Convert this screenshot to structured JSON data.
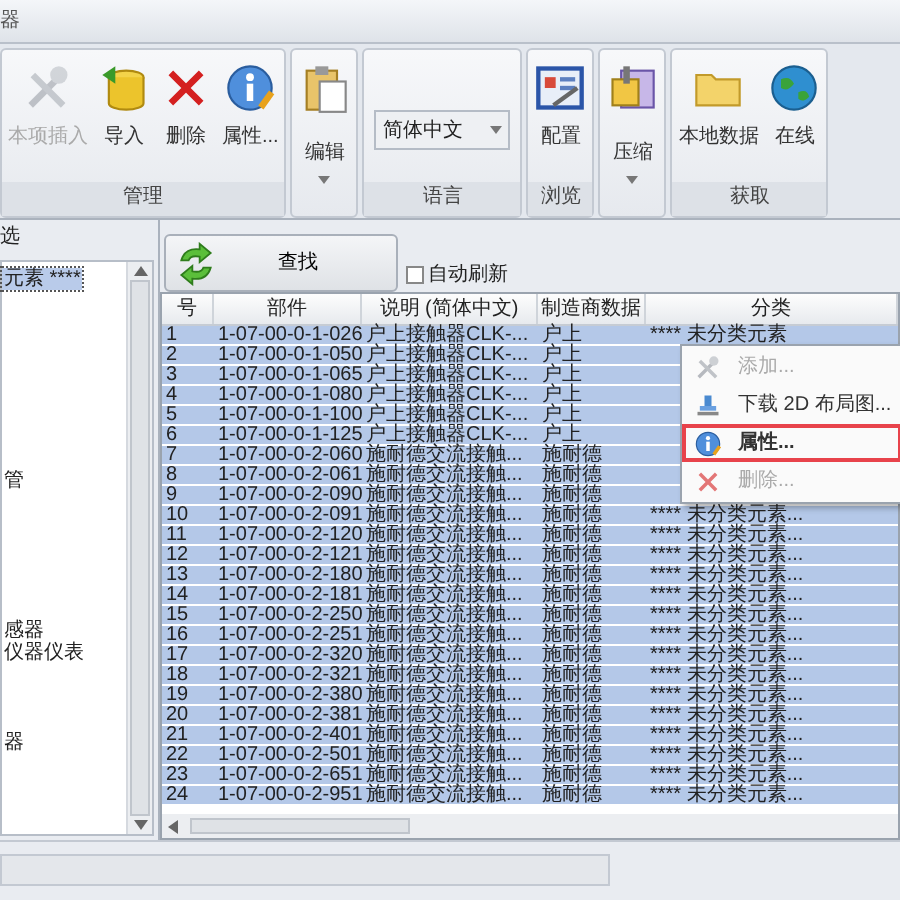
{
  "window": {
    "title": "器"
  },
  "ribbon": {
    "groups": [
      {
        "label": "管理",
        "buttons": [
          {
            "label": "本项插入",
            "disabled": true
          },
          {
            "label": "导入",
            "disabled": false
          },
          {
            "label": "删除",
            "disabled": false
          },
          {
            "label": "属性...",
            "disabled": false
          }
        ]
      },
      {
        "buttons": [
          {
            "label": "编辑",
            "disabled": false,
            "dropdown": true
          }
        ]
      },
      {
        "label": "语言",
        "select": {
          "value": "简体中文"
        }
      },
      {
        "label": "浏览",
        "buttons": [
          {
            "label": "配置",
            "disabled": false
          }
        ]
      },
      {
        "buttons": [
          {
            "label": "压缩",
            "disabled": false,
            "dropdown": true
          }
        ]
      },
      {
        "label": "获取",
        "buttons": [
          {
            "label": "本地数据",
            "disabled": false
          },
          {
            "label": "在线",
            "disabled": false
          }
        ]
      }
    ]
  },
  "left_panel": {
    "header": "选",
    "tree": [
      {
        "label": "元素 ****",
        "selected": true
      },
      {
        "label": "管",
        "selected": false
      },
      {
        "label": "感器",
        "selected": false
      },
      {
        "label": "仪器仪表",
        "selected": false
      },
      {
        "label": "器",
        "selected": false
      }
    ]
  },
  "find_button": "查找",
  "auto_refresh": {
    "label": "自动刷新",
    "checked": false
  },
  "table": {
    "columns": [
      "号",
      "部件",
      "说明 (简体中文)",
      "制造商数据",
      "分类"
    ],
    "rows": [
      {
        "cells": [
          "1",
          "1-07-00-0-1-026",
          "户上接触器CLK-...",
          "户上",
          "**** 未分类元素"
        ],
        "selected": true
      },
      {
        "cells": [
          "2",
          "1-07-00-0-1-050",
          "户上接触器CLK-...",
          "户上"
        ],
        "selected": true
      },
      {
        "cells": [
          "3",
          "1-07-00-0-1-065",
          "户上接触器CLK-...",
          "户上"
        ],
        "selected": true
      },
      {
        "cells": [
          "4",
          "1-07-00-0-1-080",
          "户上接触器CLK-...",
          "户上"
        ],
        "selected": true
      },
      {
        "cells": [
          "5",
          "1-07-00-0-1-100",
          "户上接触器CLK-...",
          "户上"
        ],
        "selected": true
      },
      {
        "cells": [
          "6",
          "1-07-00-0-1-125",
          "户上接触器CLK-...",
          "户上"
        ],
        "selected": true
      },
      {
        "cells": [
          "7",
          "1-07-00-0-2-060",
          "施耐德交流接触...",
          "施耐德"
        ],
        "selected": true
      },
      {
        "cells": [
          "8",
          "1-07-00-0-2-061",
          "施耐德交流接触...",
          "施耐德"
        ],
        "selected": true
      },
      {
        "cells": [
          "9",
          "1-07-00-0-2-090",
          "施耐德交流接触...",
          "施耐德"
        ],
        "selected": true
      },
      {
        "cells": [
          "10",
          "1-07-00-0-2-091",
          "施耐德交流接触...",
          "施耐德",
          "**** 未分类元素..."
        ],
        "selected": true
      },
      {
        "cells": [
          "11",
          "1-07-00-0-2-120",
          "施耐德交流接触...",
          "施耐德",
          "**** 未分类元素..."
        ],
        "selected": true
      },
      {
        "cells": [
          "12",
          "1-07-00-0-2-121",
          "施耐德交流接触...",
          "施耐德",
          "**** 未分类元素..."
        ],
        "selected": true
      },
      {
        "cells": [
          "13",
          "1-07-00-0-2-180",
          "施耐德交流接触...",
          "施耐德",
          "**** 未分类元素..."
        ],
        "selected": true
      },
      {
        "cells": [
          "14",
          "1-07-00-0-2-181",
          "施耐德交流接触...",
          "施耐德",
          "**** 未分类元素..."
        ],
        "selected": true
      },
      {
        "cells": [
          "15",
          "1-07-00-0-2-250",
          "施耐德交流接触...",
          "施耐德",
          "**** 未分类元素..."
        ],
        "selected": true
      },
      {
        "cells": [
          "16",
          "1-07-00-0-2-251",
          "施耐德交流接触...",
          "施耐德",
          "**** 未分类元素..."
        ],
        "selected": true
      },
      {
        "cells": [
          "17",
          "1-07-00-0-2-320",
          "施耐德交流接触...",
          "施耐德",
          "**** 未分类元素..."
        ],
        "selected": true
      },
      {
        "cells": [
          "18",
          "1-07-00-0-2-321",
          "施耐德交流接触...",
          "施耐德",
          "**** 未分类元素..."
        ],
        "selected": true
      },
      {
        "cells": [
          "19",
          "1-07-00-0-2-380",
          "施耐德交流接触...",
          "施耐德",
          "**** 未分类元素..."
        ],
        "selected": true
      },
      {
        "cells": [
          "20",
          "1-07-00-0-2-381",
          "施耐德交流接触...",
          "施耐德",
          "**** 未分类元素..."
        ],
        "selected": true
      },
      {
        "cells": [
          "21",
          "1-07-00-0-2-401",
          "施耐德交流接触...",
          "施耐德",
          "**** 未分类元素..."
        ],
        "selected": true
      },
      {
        "cells": [
          "22",
          "1-07-00-0-2-501",
          "施耐德交流接触...",
          "施耐德",
          "**** 未分类元素..."
        ],
        "selected": true
      },
      {
        "cells": [
          "23",
          "1-07-00-0-2-651",
          "施耐德交流接触...",
          "施耐德",
          "**** 未分类元素..."
        ],
        "selected": true
      },
      {
        "cells": [
          "24",
          "1-07-00-0-2-951",
          "施耐德交流接触...",
          "施耐德",
          "**** 未分类元素..."
        ],
        "selected": true
      }
    ]
  },
  "context_menu": [
    {
      "label": "添加...",
      "disabled": true,
      "selected": false
    },
    {
      "label": "下载 2D 布局图...",
      "disabled": false,
      "selected": false
    },
    {
      "label": "属性...",
      "disabled": false,
      "selected": true
    },
    {
      "label": "删除...",
      "disabled": true,
      "selected": false
    }
  ]
}
